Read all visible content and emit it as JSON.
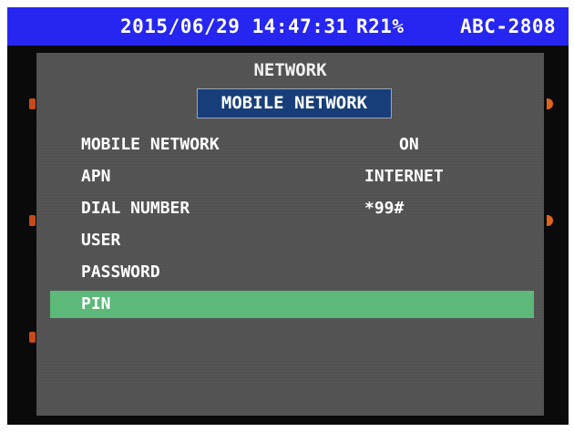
{
  "status_bar": {
    "datetime": "2015/06/29 14:47:31",
    "recording": "R21%",
    "device_id": "ABC-2808",
    "background_color": "#2626f0"
  },
  "menu": {
    "title": "NETWORK",
    "submenu": "MOBILE NETWORK",
    "selected_color": "#5cb97a",
    "rows": [
      {
        "label": "MOBILE NETWORK",
        "value": "ON"
      },
      {
        "label": "APN",
        "value": "INTERNET"
      },
      {
        "label": "DIAL NUMBER",
        "value": "*99#"
      },
      {
        "label": "USER",
        "value": ""
      },
      {
        "label": "PASSWORD",
        "value": ""
      },
      {
        "label": "PIN",
        "value": "",
        "selected": true
      }
    ]
  }
}
